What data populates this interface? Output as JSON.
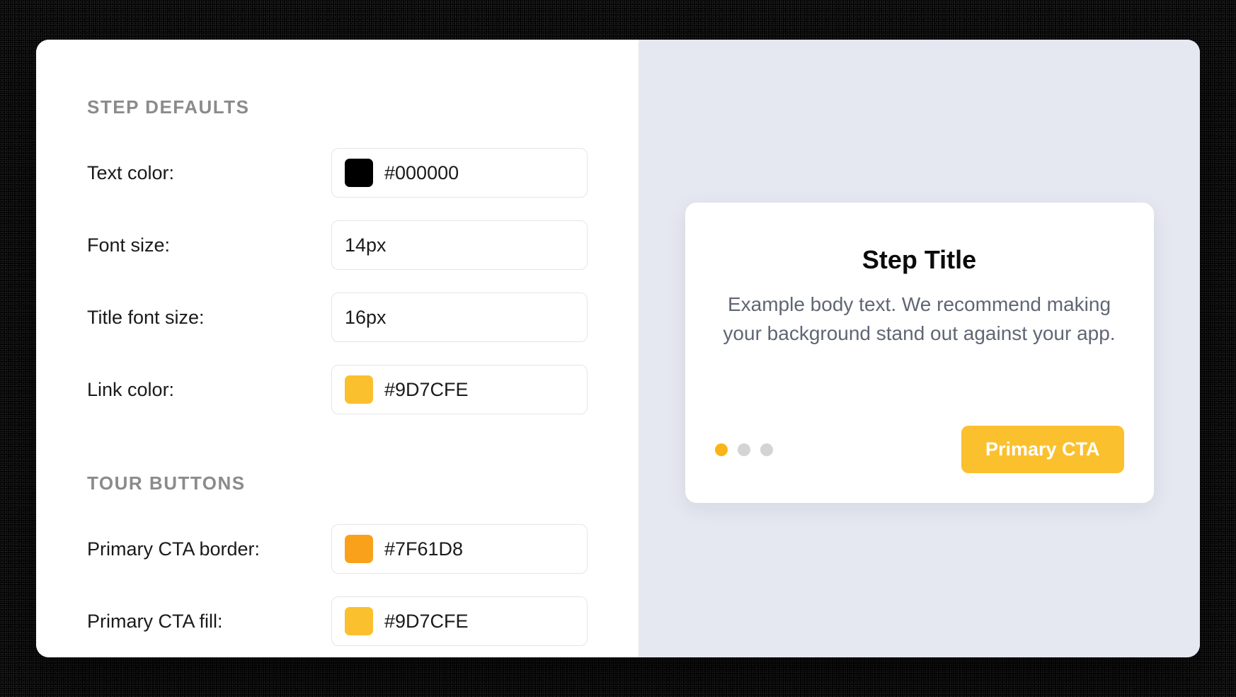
{
  "sections": {
    "stepDefaults": {
      "header": "STEP DEFAULTS",
      "fields": {
        "textColor": {
          "label": "Text color:",
          "value": "#000000",
          "swatch": "#000000"
        },
        "fontSize": {
          "label": "Font size:",
          "value": "14px"
        },
        "titleFontSize": {
          "label": "Title font size:",
          "value": "16px"
        },
        "linkColor": {
          "label": "Link color:",
          "value": "#9D7CFE",
          "swatch": "#fbc02d"
        }
      }
    },
    "tourButtons": {
      "header": "TOUR BUTTONS",
      "fields": {
        "primaryCtaBorder": {
          "label": "Primary CTA border:",
          "value": "#7F61D8",
          "swatch": "#f9a11b"
        },
        "primaryCtaFill": {
          "label": "Primary CTA fill:",
          "value": "#9D7CFE",
          "swatch": "#fbc02d"
        }
      }
    }
  },
  "preview": {
    "title": "Step Title",
    "body": "Example body text. We recommend making your background stand out against your app.",
    "cta": "Primary CTA",
    "dots": {
      "count": 3,
      "activeIndex": 0,
      "activeColor": "#f9b518",
      "inactiveColor": "#d4d4d4"
    }
  }
}
